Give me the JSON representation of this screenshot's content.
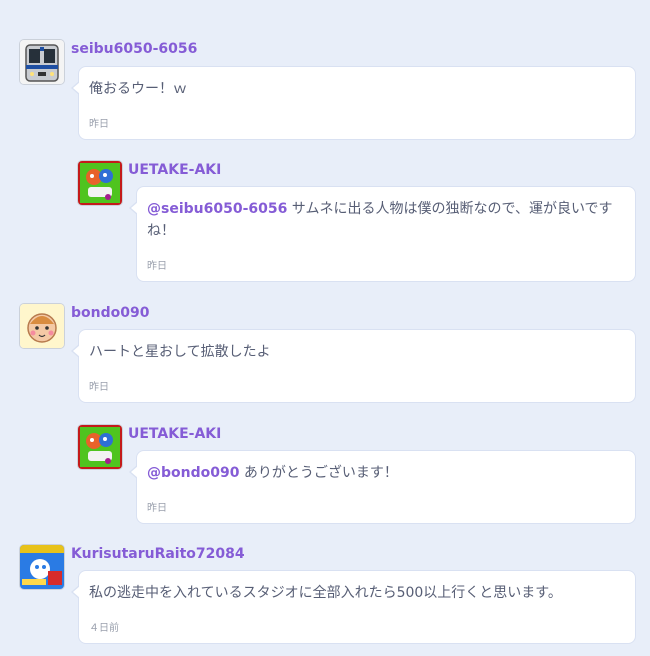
{
  "comments": [
    {
      "username": "seibu6050-6056",
      "mention": "",
      "text": "俺おるウー！ｗ",
      "time": "昨日",
      "avatar_icon": "train-avatar-icon"
    },
    {
      "username": "UETAKE-AKI",
      "mention": "@seibu6050-6056",
      "text": " サムネに出る人物は僕の独断なので、運が良いですね！",
      "time": "昨日",
      "avatar_icon": "character-avatar-icon"
    },
    {
      "username": "bondo090",
      "mention": "",
      "text": "ハートと星おして拡散したよ",
      "time": "昨日",
      "avatar_icon": "cat-avatar-icon"
    },
    {
      "username": "UETAKE-AKI",
      "mention": "@bondo090",
      "text": " ありがとうございます！",
      "time": "昨日",
      "avatar_icon": "character-avatar-icon"
    },
    {
      "username": "KurisutaruRaito72084",
      "mention": "",
      "text": "私の逃走中を入れているスタジオに全部入れたら500以上行くと思います。",
      "time": "４日前",
      "avatar_icon": "game-avatar-icon"
    }
  ],
  "colors": {
    "background": "#e8eef9",
    "username": "#855cd6",
    "text": "#575e75",
    "time": "#9aa0ad"
  }
}
